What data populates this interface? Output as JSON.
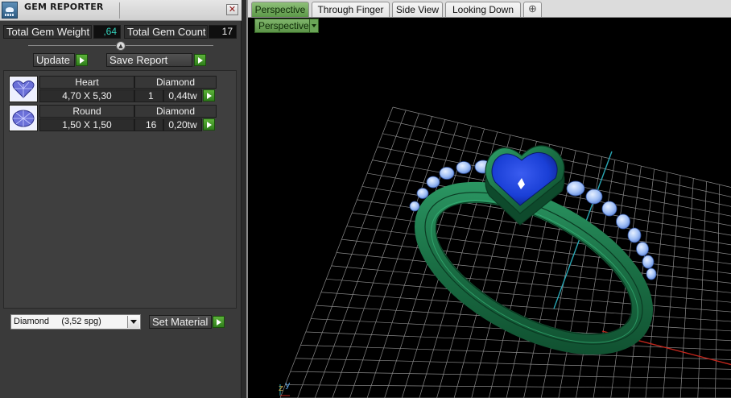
{
  "panel": {
    "title": "GEM REPORTER",
    "close_label": "✕",
    "total_weight_label": "Total Gem Weight",
    "total_weight_value": ",64",
    "total_count_label": "Total Gem Count",
    "total_count_value": "17",
    "update_label": "Update",
    "save_report_label": "Save Report",
    "gems": [
      {
        "shape": "Heart",
        "material": "Diamond",
        "size": "4,70 X 5,30",
        "count": "1",
        "weight": "0,44tw",
        "icon": "heart-gem-icon"
      },
      {
        "shape": "Round",
        "material": "Diamond",
        "size": "1,50 X 1,50",
        "count": "16",
        "weight": "0,20tw",
        "icon": "round-gem-icon"
      }
    ],
    "material_select": {
      "name": "Diamond",
      "density": "(3,52 spg)"
    },
    "set_material_label": "Set Material"
  },
  "viewport": {
    "tabs": [
      {
        "label": "Perspective",
        "active": true
      },
      {
        "label": "Through Finger",
        "active": false
      },
      {
        "label": "Side View",
        "active": false
      },
      {
        "label": "Looking Down",
        "active": false
      }
    ],
    "add_tab_label": "⊕",
    "view_mode": "Perspective",
    "axis_x_label": "z",
    "axis_y_label": "y"
  },
  "colors": {
    "accent_green": "#5c9848",
    "ring_green": "#1e7a4c",
    "gem_blue": "#1a3fd6",
    "grid_line": "#8a8a8a",
    "axis_cyan": "#2aa7b5",
    "axis_red": "#c0261c",
    "weight_text": "#33d0ba"
  }
}
